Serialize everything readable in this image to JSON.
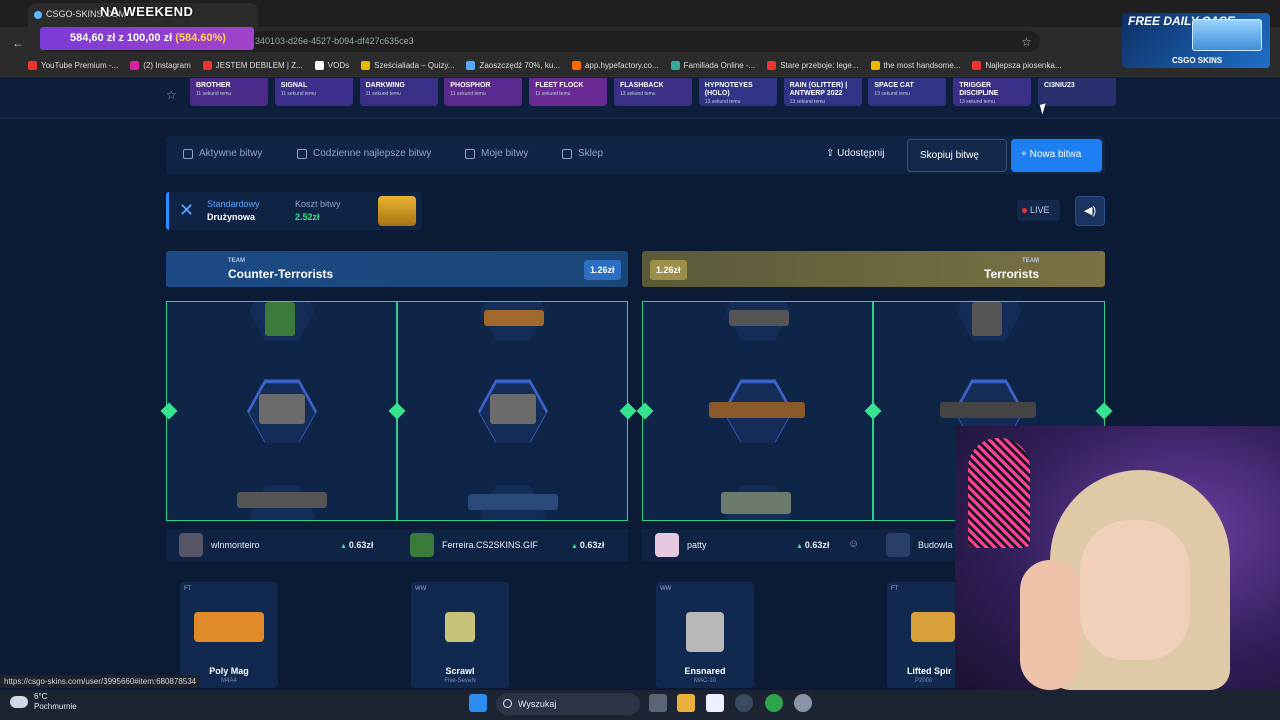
{
  "browser": {
    "tab_title": "CSGO-SKINS.COM",
    "url_fragment": "340103-d26e-4527-b094-df427c635ce3",
    "status_url": "https://csgo-skins.com/user/3995660#item:680878534",
    "bookmarks": [
      {
        "label": "YouTube Premium -...",
        "color": "#e33"
      },
      {
        "label": "(2) Instagram",
        "color": "#d6249f"
      },
      {
        "label": "JESTEM DEBILEM | Z...",
        "color": "#e33"
      },
      {
        "label": "VODs",
        "color": "#fff"
      },
      {
        "label": "Sześcialiada – Quizy...",
        "color": "#e6b800"
      },
      {
        "label": "Zaoszczędź 70%, ku...",
        "color": "#5aa6ff"
      },
      {
        "label": "app.hypefactory.co...",
        "color": "#ff6a00"
      },
      {
        "label": "Familiada Online -...",
        "color": "#3a9"
      },
      {
        "label": "Stare przeboje: lege...",
        "color": "#e33"
      },
      {
        "label": "the most handsome...",
        "color": "#e6b800"
      },
      {
        "label": "Najlepsza piosenka...",
        "color": "#e33"
      }
    ]
  },
  "overlay": {
    "weekend": "NA WEEKEND",
    "profit_main": "584,60 zł",
    "profit_of": "z 100,00 zł",
    "profit_pct": "(584.60%)",
    "promo_title": "FREE DAILY CASE",
    "promo_brand": "CSGO SKINS"
  },
  "drops": [
    {
      "name": "BROTHER",
      "sub": "11 sekund temu",
      "color": "#4b2a8a"
    },
    {
      "name": "SIGNAL",
      "sub": "11 sekund temu",
      "color": "#3d2f8c"
    },
    {
      "name": "DARKWING",
      "sub": "11 sekund temu",
      "color": "#3a2f86"
    },
    {
      "name": "PHOSPHOR",
      "sub": "11 sekund temu",
      "color": "#5a2a8e"
    },
    {
      "name": "FLEET FLOCK",
      "sub": "11 sekund temu",
      "color": "#6a2a96"
    },
    {
      "name": "FLASHBACK",
      "sub": "13 sekund temu",
      "color": "#3c2f86"
    },
    {
      "name": "HYPNOTEYES (HOLO)",
      "sub": "13 sekund temu",
      "color": "#2f3486"
    },
    {
      "name": "RAIN (GLITTER) | ANTWERP 2022",
      "sub": "13 sekund temu",
      "color": "#2f3486"
    },
    {
      "name": "SPACE CAT",
      "sub": "13 sekund temu",
      "color": "#2f3486"
    },
    {
      "name": "TRIGGER DISCIPLINE",
      "sub": "13 sekund temu",
      "color": "#3a2f86"
    },
    {
      "name": "CI3NIU23",
      "sub": "",
      "color": "#2a2f6e"
    }
  ],
  "nav": {
    "items": [
      "Aktywne bitwy",
      "Codzienne najlepsze bitwy",
      "Moje bitwy",
      "Sklep"
    ],
    "share": "Udostępnij",
    "copy": "Skopiuj bitwę",
    "new": "+ Nowa bitwa"
  },
  "battle": {
    "mode_label": "Standardowy",
    "mode_value": "Drużynowa",
    "cost_label": "Koszt bitwy",
    "cost_value": "2.52zł",
    "live": "LIVE"
  },
  "teams": {
    "ct": {
      "small": "TEAM",
      "name": "Counter-Terrorists",
      "value": "1.26zł"
    },
    "t": {
      "small": "TEAM",
      "name": "Terrorists",
      "value": "1.26zł"
    }
  },
  "players": [
    {
      "name": "wlnmonteiro",
      "value": "0.63zł",
      "card": {
        "quality": "FT",
        "name": "Poly Mag",
        "sub": "M4A4",
        "color": "#e08a2a"
      }
    },
    {
      "name": "Ferreira.CS2SKINS.GIF",
      "value": "0.63zł",
      "card": {
        "quality": "WW",
        "name": "Scrawl",
        "sub": "Five-SeveN",
        "color": "#c7c37a"
      }
    },
    {
      "name": "patty",
      "value": "0.63zł",
      "card": {
        "quality": "WW",
        "name": "Ensnared",
        "sub": "MAC-10",
        "color": "#b8b8b8"
      }
    },
    {
      "name": "Budowla",
      "value": "",
      "card": {
        "quality": "FT",
        "name": "Lifted Spir",
        "sub": "P2000",
        "color": "#d8a03a"
      }
    }
  ],
  "taskbar": {
    "temp": "6°C",
    "weather": "Pochmurnie",
    "search": "Wyszukaj"
  }
}
